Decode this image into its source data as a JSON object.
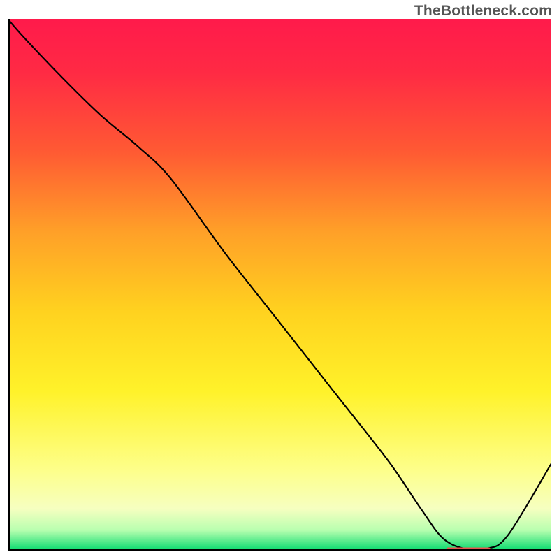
{
  "attribution": "TheBottleneck.com",
  "colors": {
    "gradient_stops": [
      {
        "offset": 0.0,
        "color": "#ff1a4b"
      },
      {
        "offset": 0.1,
        "color": "#ff2a44"
      },
      {
        "offset": 0.25,
        "color": "#ff5a33"
      },
      {
        "offset": 0.4,
        "color": "#ffa028"
      },
      {
        "offset": 0.55,
        "color": "#ffd21f"
      },
      {
        "offset": 0.7,
        "color": "#fff22a"
      },
      {
        "offset": 0.85,
        "color": "#fdff8c"
      },
      {
        "offset": 0.92,
        "color": "#f6ffc0"
      },
      {
        "offset": 0.96,
        "color": "#b9ffb0"
      },
      {
        "offset": 1.0,
        "color": "#00d96c"
      }
    ],
    "axis": "#000000",
    "curve": "#000000",
    "marker": "#e8534e"
  },
  "axes": {
    "x_range": [
      0,
      1
    ],
    "y_range": [
      0,
      1
    ]
  },
  "chart_data": {
    "type": "line",
    "title": "",
    "xlabel": "",
    "ylabel": "",
    "xlim": [
      0,
      1
    ],
    "ylim": [
      0,
      1
    ],
    "series": [
      {
        "name": "curve",
        "x": [
          0.0,
          0.03,
          0.1,
          0.17,
          0.24,
          0.3,
          0.4,
          0.5,
          0.6,
          0.7,
          0.76,
          0.8,
          0.84,
          0.88,
          0.92,
          1.0
        ],
        "y": [
          1.0,
          0.965,
          0.89,
          0.82,
          0.76,
          0.7,
          0.56,
          0.43,
          0.3,
          0.17,
          0.08,
          0.025,
          0.005,
          0.005,
          0.03,
          0.165
        ]
      }
    ],
    "marker": {
      "name": "highlight-segment",
      "x_start": 0.81,
      "x_end": 0.885,
      "y": 0.004
    }
  }
}
